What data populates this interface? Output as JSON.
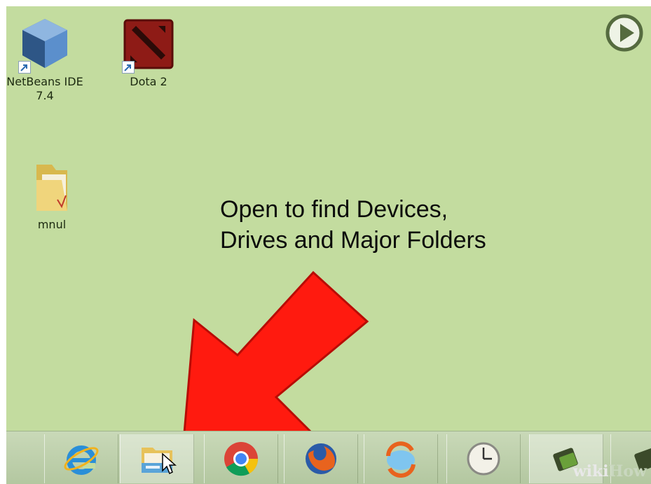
{
  "desktop": {
    "icons": [
      {
        "label_line1": "NetBeans IDE",
        "label_line2": "7.4",
        "icon": "netbeans-icon"
      },
      {
        "label_line1": "Dota 2",
        "icon": "dota2-icon"
      },
      {
        "label_line1": "mnul",
        "icon": "folder-icon"
      }
    ]
  },
  "overlay": {
    "line1": "Open to find Devices,",
    "line2": "Drives and Major Folders",
    "arrow_color": "#ff1a0f"
  },
  "taskbar": {
    "items": [
      {
        "icon": "internet-explorer-icon"
      },
      {
        "icon": "file-explorer-icon",
        "pointed": true
      },
      {
        "icon": "chrome-icon"
      },
      {
        "icon": "firefox-icon"
      },
      {
        "icon": "sync-icon"
      },
      {
        "icon": "clock-icon"
      },
      {
        "icon": "app-icon"
      },
      {
        "icon": "app-icon"
      }
    ]
  },
  "watermark": {
    "text_w": "wiki",
    "text_h": "How"
  },
  "colors": {
    "desktop": "#c3dc9f",
    "accent_red": "#ff1a0f"
  }
}
